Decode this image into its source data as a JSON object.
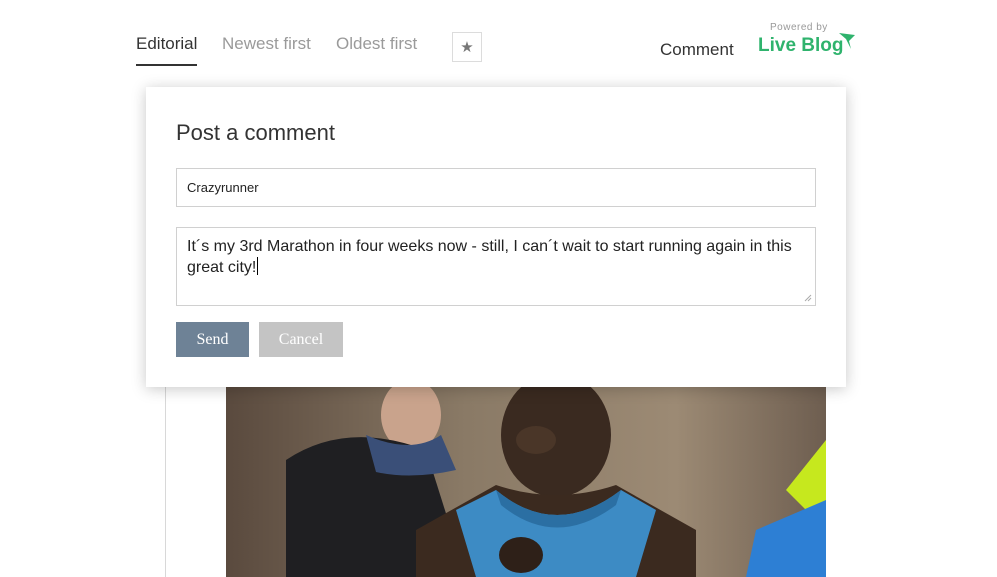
{
  "nav": {
    "tabs": [
      {
        "label": "Editorial",
        "active": true
      },
      {
        "label": "Newest first",
        "active": false
      },
      {
        "label": "Oldest first",
        "active": false
      }
    ],
    "star_icon": "star-icon",
    "comment_label": "Comment"
  },
  "branding": {
    "powered_by": "Powered by",
    "name": "Live Blog",
    "color": "#2fb36d"
  },
  "modal": {
    "title": "Post a comment",
    "name_value": "Crazyrunner",
    "comment_value": "It´s my 3rd Marathon in four weeks now - still, I can´t wait to start running again in this great city!",
    "send_label": "Send",
    "cancel_label": "Cancel",
    "send_color": "#6e8296",
    "cancel_color": "#c4c4c4"
  },
  "post": {
    "image": "marathon-runner-photo"
  }
}
